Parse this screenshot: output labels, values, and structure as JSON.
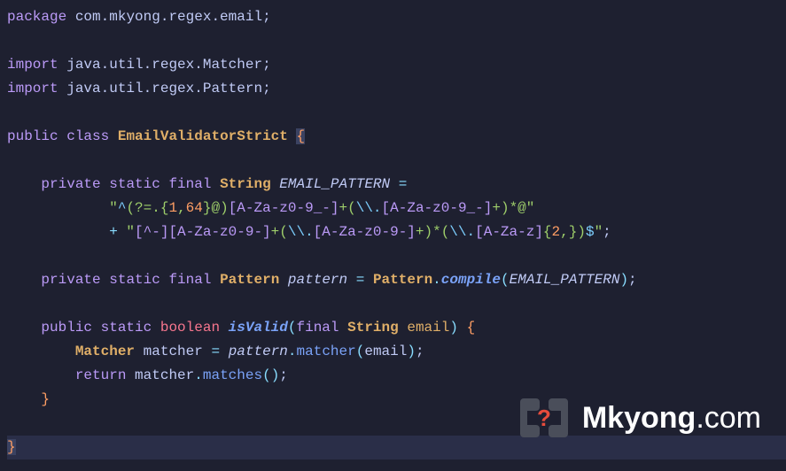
{
  "code": {
    "package_kw": "package",
    "package_ns": "com.mkyong.regex.email",
    "import_kw": "import",
    "import1": "java.util.regex.Matcher",
    "import2": "java.util.regex.Pattern",
    "public_kw": "public",
    "class_kw": "class",
    "classname": "EmailValidatorStrict",
    "private_kw": "private",
    "static_kw": "static",
    "final_kw": "final",
    "string_type": "String",
    "const_name": "EMAIL_PATTERN",
    "eq": "=",
    "regex1_open": "\"",
    "regex1_caret": "^",
    "regex1_a": "(?=.{",
    "regex1_n1": "1",
    "regex1_c1": ",",
    "regex1_n2": "64",
    "regex1_b": "}@)",
    "regex1_cls1": "[A-Za-z0-9_-]",
    "regex1_plus1": "+(",
    "regex1_esc1": "\\\\.",
    "regex1_cls2": "[A-Za-z0-9_-]",
    "regex1_c": "+)*@",
    "regex1_close": "\"",
    "plus_op": "+ ",
    "regex2_open": "\"",
    "regex2_cls1": "[^-]",
    "regex2_cls2": "[A-Za-z0-9-]",
    "regex2_plus1": "+(",
    "regex2_esc1": "\\\\.",
    "regex2_cls3": "[A-Za-z0-9-]",
    "regex2_a": "+)*(",
    "regex2_esc2": "\\\\.",
    "regex2_cls4": "[A-Za-z]",
    "regex2_b": "{",
    "regex2_n1": "2",
    "regex2_c": ",})",
    "regex2_dollar": "$",
    "regex2_close": "\"",
    "pattern_type": "Pattern",
    "pattern_var": "pattern",
    "pattern_cls": "Pattern",
    "compile": "compile",
    "boolean": "boolean",
    "isvalid": "isValid",
    "email_param": "email",
    "matcher_type": "Matcher",
    "matcher_var": "matcher",
    "matcher_call": "matcher",
    "return_kw": "return",
    "matches": "matches",
    "semicolon": ";",
    "open_brace": "{",
    "close_brace": "}",
    "paren_open": "(",
    "paren_close": ")",
    "dot": "."
  },
  "logo": {
    "brand_bold": "Mkyong",
    "brand_tld": ".com"
  }
}
